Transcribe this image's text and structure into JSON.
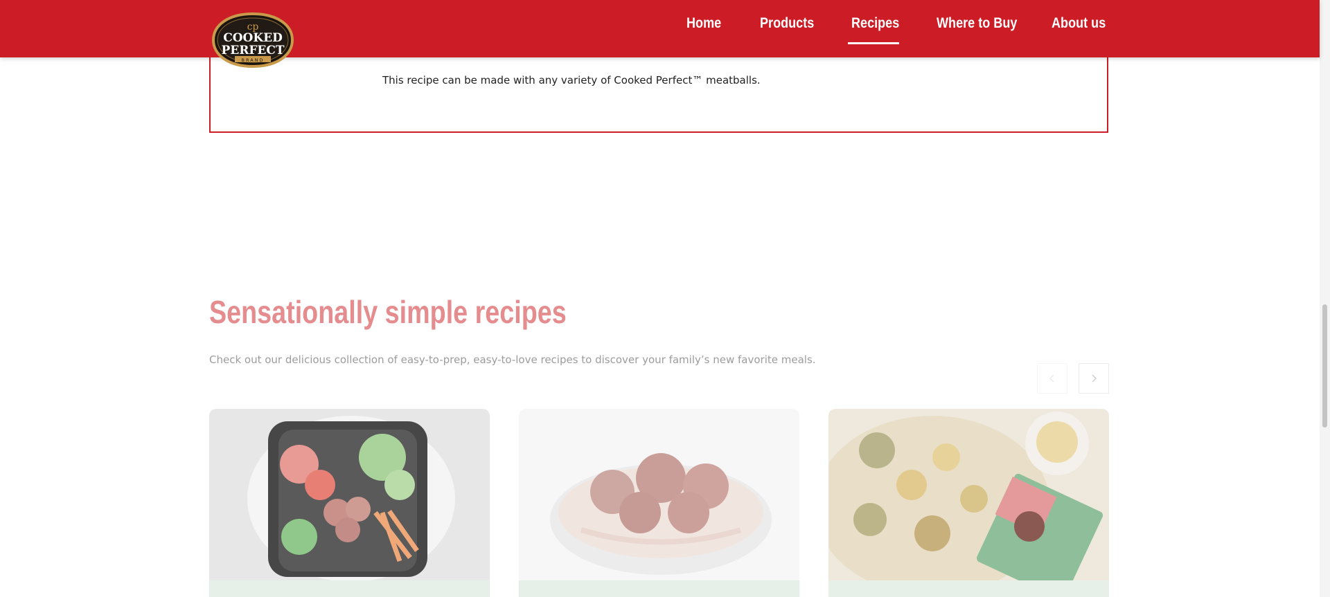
{
  "header": {
    "logo_lines": [
      "COOKED",
      "PERFECT",
      "BRAND"
    ],
    "nav": [
      {
        "label": "Home",
        "active": false
      },
      {
        "label": "Products",
        "active": false
      },
      {
        "label": "Recipes",
        "active": true
      },
      {
        "label": "Where to Buy",
        "active": false
      },
      {
        "label": "About us",
        "active": false
      }
    ],
    "brand_color": "#cc1c26"
  },
  "recipe_note": "This recipe can be made with any variety of Cooked Perfect™ meatballs.",
  "section": {
    "title": "Sensationally simple recipes",
    "description": "Check out our delicious collection of easy-to-prep, easy-to-love recipes to discover your family’s new favorite meals.",
    "prev_icon": "chevron-left-icon",
    "next_icon": "chevron-right-icon"
  },
  "cards": [
    {
      "image": "meatball-salad-bowl"
    },
    {
      "image": "meatballs-pasta-bowl"
    },
    {
      "image": "turkey-meatball-casserole"
    }
  ]
}
